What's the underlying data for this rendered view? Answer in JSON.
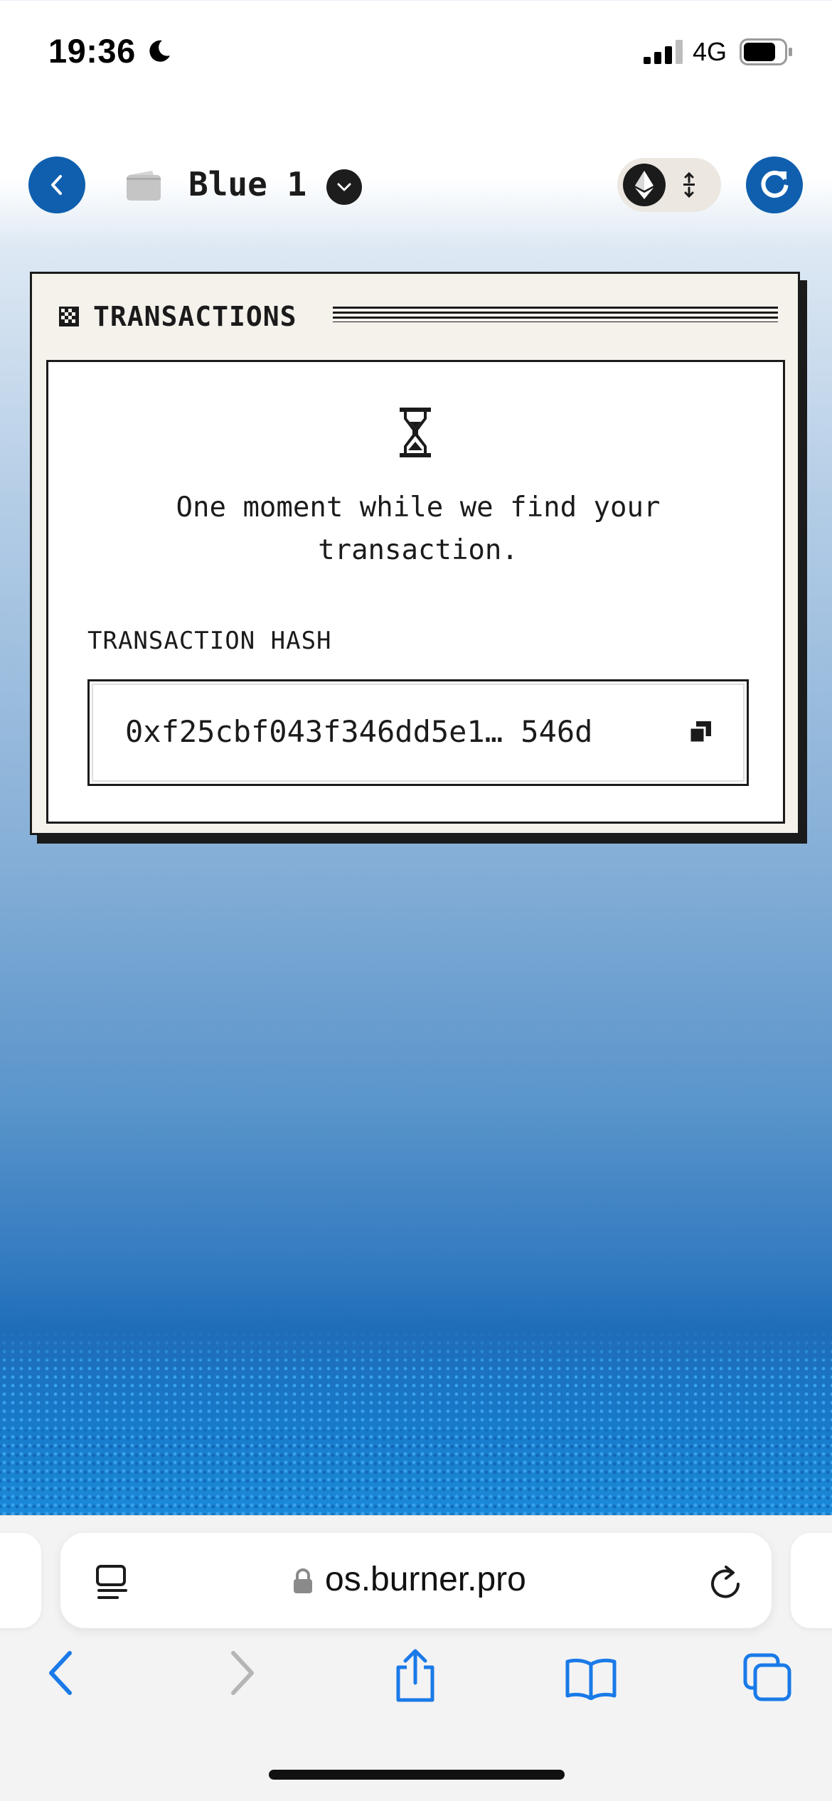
{
  "status_bar": {
    "time": "19:36",
    "network": "4G",
    "focus_mode_icon": "moon-icon",
    "signal_icon": "signal-bars-icon",
    "battery_icon": "battery-icon"
  },
  "header": {
    "back_icon": "chevron-left-icon",
    "wallet_icon": "wallet-icon",
    "wallet_name": "Blue 1",
    "wallet_dropdown_icon": "chevron-down-icon",
    "network_icon": "ethereum-icon",
    "network_switch_icon": "swap-arrows-icon",
    "refresh_icon": "refresh-icon"
  },
  "transactions_window": {
    "title": "TRANSACTIONS",
    "title_icon": "checkerboard-icon",
    "loading_icon": "hourglass-icon",
    "loading_message": "One moment while we find your transaction.",
    "hash_label": "TRANSACTION HASH",
    "hash_value": "0xf25cbf043f346dd5e1… 546d",
    "copy_icon": "copy-icon"
  },
  "browser": {
    "url": "os.burner.pro",
    "reader_icon": "page-menu-icon",
    "lock_icon": "lock-icon",
    "reload_icon": "reload-icon",
    "toolbar": [
      "back-icon",
      "forward-icon",
      "share-icon",
      "bookmarks-icon",
      "tabs-icon"
    ]
  },
  "colors": {
    "accent": "#0f5fae",
    "ink": "#1b1b1b",
    "window_bg": "#f5f2ec",
    "browser_blue": "#1a7ae8"
  }
}
